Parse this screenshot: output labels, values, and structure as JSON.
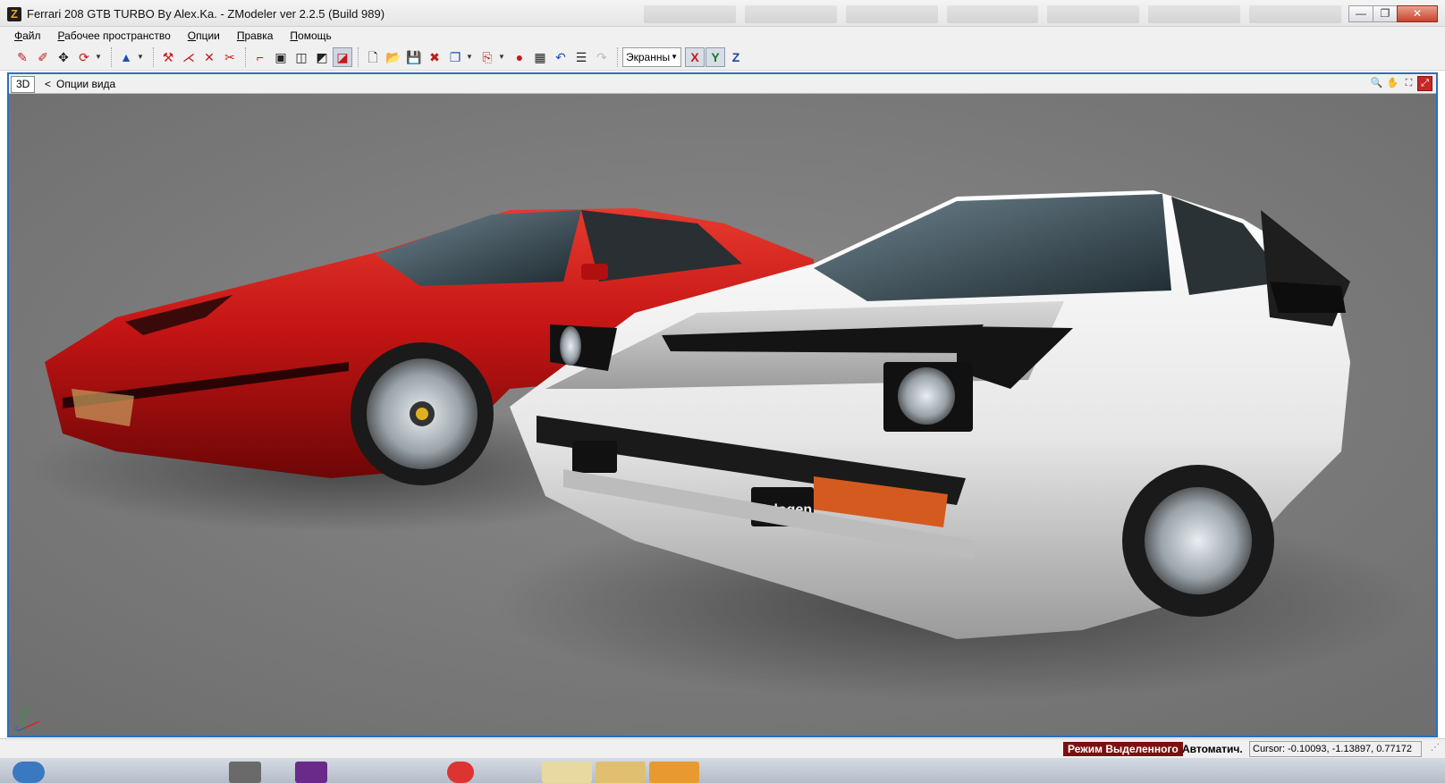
{
  "window": {
    "title": "Ferrari 208 GTB TURBO By Alex.Ka. - ZModeler ver 2.2.5 (Build 989)",
    "app_icon_letter": "Z",
    "minimize_glyph": "—",
    "maximize_glyph": "❐",
    "close_glyph": "✕"
  },
  "menu": {
    "items": [
      "Файл",
      "Рабочее пространство",
      "Опции",
      "Правка",
      "Помощь"
    ]
  },
  "toolbar": {
    "view_mode": "Экранны",
    "axis_x": "X",
    "axis_y": "Y",
    "axis_z": "Z",
    "icons": [
      "select-vertices-icon",
      "select-polygons-icon",
      "move-icon",
      "rotate-icon",
      "scale-icon",
      "mirror-icon",
      "weld-icon",
      "split-icon",
      "cut-icon",
      "extrude-icon",
      "create-box-icon",
      "create-cylinder-icon",
      "create-sphere-icon",
      "create-plane-icon",
      "new-file-icon",
      "open-file-icon",
      "save-file-icon",
      "delete-icon",
      "copy-icon",
      "paste-icon",
      "render-icon",
      "material-icon",
      "undo-icon",
      "properties-icon",
      "redo-icon"
    ]
  },
  "viewport": {
    "tag": "3D",
    "arrow": "<",
    "title": "Опции вида",
    "background": "#7a7a7a",
    "plate_text": "Halogen",
    "axis_y_label": "y",
    "axis_z_label": "z"
  },
  "status": {
    "mode": "Режим Выделенного",
    "auto": "Автоматич.",
    "cursor": "Cursor: -0.10093, -1.13897, 0.77172"
  },
  "colors": {
    "accent": "#2b6fbf",
    "mode_badge": "#7b1010",
    "red_car": "#c41414",
    "white_car": "#f2f2f2"
  }
}
